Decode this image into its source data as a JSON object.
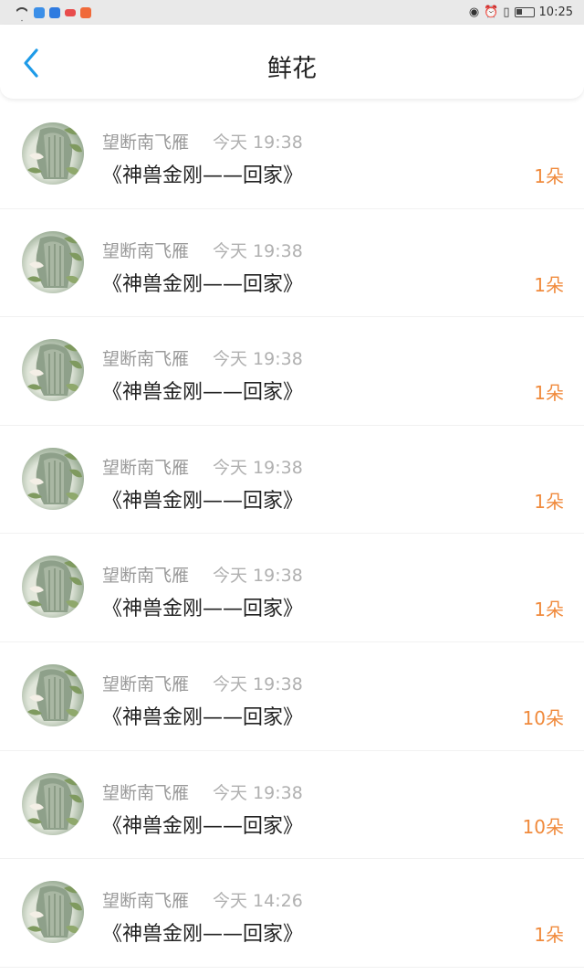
{
  "status_bar": {
    "time": "10:25"
  },
  "header": {
    "title": "鲜花",
    "back_icon": "chevron-left-icon"
  },
  "colors": {
    "back_icon": "#1e9be8",
    "count": "#f08a3c",
    "name": "#9a9a9a",
    "time": "#b0b0b0"
  },
  "items": [
    {
      "name": "望断南飞雁",
      "time": "今天 19:38",
      "title": "《神兽金刚——回家》",
      "count": "1朵"
    },
    {
      "name": "望断南飞雁",
      "time": "今天 19:38",
      "title": "《神兽金刚——回家》",
      "count": "1朵"
    },
    {
      "name": "望断南飞雁",
      "time": "今天 19:38",
      "title": "《神兽金刚——回家》",
      "count": "1朵"
    },
    {
      "name": "望断南飞雁",
      "time": "今天 19:38",
      "title": "《神兽金刚——回家》",
      "count": "1朵"
    },
    {
      "name": "望断南飞雁",
      "time": "今天 19:38",
      "title": "《神兽金刚——回家》",
      "count": "1朵"
    },
    {
      "name": "望断南飞雁",
      "time": "今天 19:38",
      "title": "《神兽金刚——回家》",
      "count": "10朵"
    },
    {
      "name": "望断南飞雁",
      "time": "今天 19:38",
      "title": "《神兽金刚——回家》",
      "count": "10朵"
    },
    {
      "name": "望断南飞雁",
      "time": "今天 14:26",
      "title": "《神兽金刚——回家》",
      "count": "1朵"
    }
  ]
}
